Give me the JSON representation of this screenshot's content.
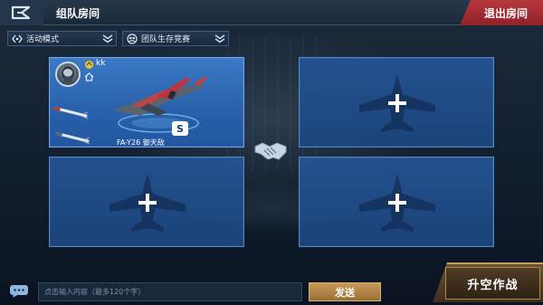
{
  "header": {
    "title": "组队房间",
    "exit_label": "退出房间"
  },
  "filters": {
    "mode_label": "活动模式",
    "game_type_label": "团队生存竞赛"
  },
  "slots": [
    {
      "occupied": true,
      "player_name": "kk",
      "aircraft_name": "FA-Y26 御天敌",
      "badge": "S"
    },
    {
      "occupied": false
    },
    {
      "occupied": false
    },
    {
      "occupied": false
    }
  ],
  "chat": {
    "placeholder": "点击输入内容（最多120个字）",
    "send_label": "发送"
  },
  "launch_label": "升空作战",
  "colors": {
    "exit_red": "#b6383e",
    "slot_blue": "#2a62ad",
    "empty_slot_blue": "#24559a",
    "gold": "#c79a5a"
  }
}
